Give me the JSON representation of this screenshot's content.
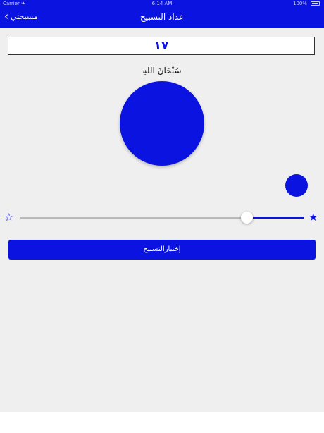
{
  "status_bar": {
    "carrier": "Carrier ✈",
    "time": "6:14 AM",
    "battery": "100%"
  },
  "nav": {
    "title": "عداد التسبيح",
    "back_label": "مسبحتي"
  },
  "counter": {
    "value": "١٧"
  },
  "dhikr": {
    "text": "سُبْحَانَ اللهِ"
  },
  "slider": {
    "value": 0.8
  },
  "actions": {
    "select_label": "إختيارالتسبيح"
  },
  "colors": {
    "accent": "#0a13df",
    "background": "#efefef"
  },
  "icons": {
    "back": "chevron-left-icon",
    "min": "star-outline-icon",
    "max": "star-filled-icon"
  }
}
